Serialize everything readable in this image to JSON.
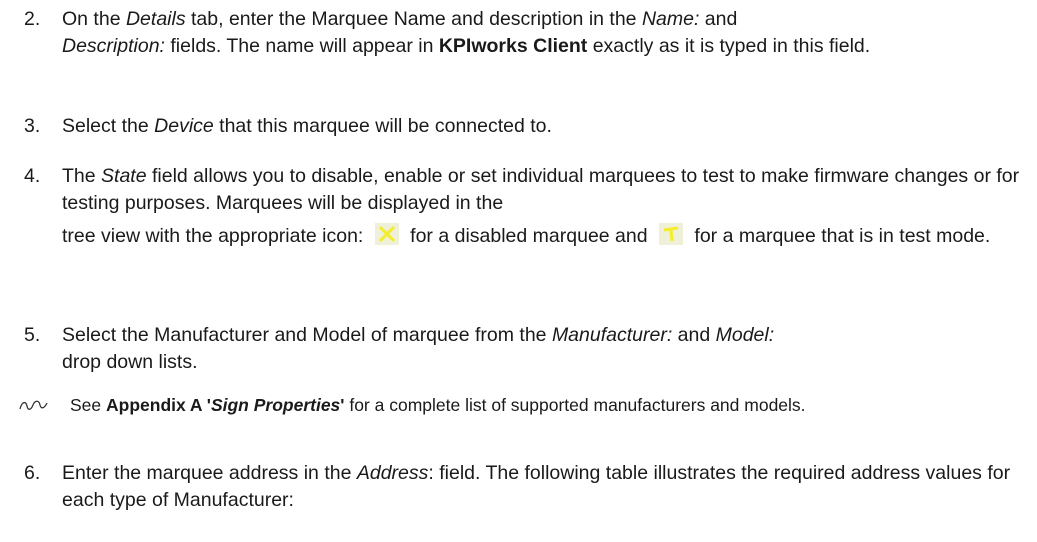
{
  "steps": [
    {
      "num": "2.",
      "t1": "On the ",
      "t1i": "Details",
      "t2": " tab, enter the Marquee Name and description in the ",
      "t2i": "Name:",
      "t3": " and ",
      "t3i": "Description:",
      "t4": " fields.  The name will appear in ",
      "t4b": "KPIworks Client",
      "t5": " exactly as it is typed in this field."
    },
    {
      "num": "3.",
      "t1": "Select the ",
      "t1i": "Device",
      "t2": " that this marquee will be connected to."
    },
    {
      "num": "4.",
      "t1": "The ",
      "t1i": "State",
      "t2": " field allows you to disable, enable or set individual marquees to test to make firmware changes or for testing purposes.  Marquees will be displayed in the",
      "t3": "tree view with the appropriate icon: ",
      "t4": " for a disabled marquee and ",
      "t5": " for a marquee that is in test mode."
    },
    {
      "num": "5.",
      "t1": "Select the Manufacturer and Model of marquee from the ",
      "t1i": "Manufacturer:",
      "t2": " and ",
      "t2i": "Model:",
      "t3": " drop down lists."
    },
    {
      "num": "6.",
      "t1": "Enter the marquee address in the ",
      "t1i": "Address",
      "t2": ": field.  The following table illustrates the required address values for each type of Manufacturer:"
    }
  ],
  "note": {
    "t1": "See ",
    "t1b": "Appendix A '",
    "t1bi": "Sign Properties",
    "t1b2": "'",
    "t2": " for a complete list of supported manufacturers and models."
  },
  "icons": {
    "disabled": "disabled-marquee-icon",
    "test": "test-mode-marquee-icon",
    "note": "pen-note-icon",
    "icon_bg": "#eef0d8",
    "icon_fg": "#f4ee2a"
  }
}
